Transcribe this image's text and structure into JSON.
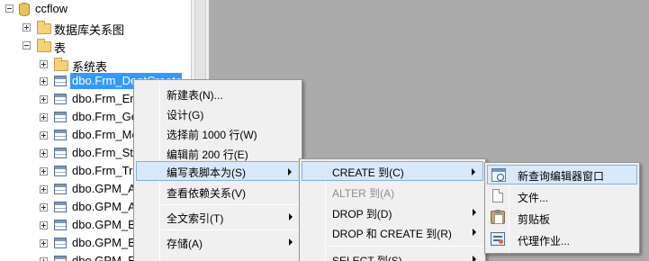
{
  "tree": {
    "nodes": [
      {
        "label": "ccflow",
        "icon": "database-icon",
        "expanded": true
      },
      {
        "label": "数据库关系图",
        "icon": "folder-icon",
        "expanded": false
      },
      {
        "label": "表",
        "icon": "folder-icon",
        "expanded": true
      },
      {
        "label": "系统表",
        "icon": "folder-icon",
        "expanded": false
      },
      {
        "label": "dbo.Frm_DeptCreate",
        "icon": "table-icon",
        "expanded": false,
        "selected": true
      },
      {
        "label": "dbo.Frm_Em",
        "icon": "table-icon",
        "expanded": false
      },
      {
        "label": "dbo.Frm_Ge",
        "icon": "table-icon",
        "expanded": false
      },
      {
        "label": "dbo.Frm_Me",
        "icon": "table-icon",
        "expanded": false
      },
      {
        "label": "dbo.Frm_Sta",
        "icon": "table-icon",
        "expanded": false
      },
      {
        "label": "dbo.Frm_Tra",
        "icon": "table-icon",
        "expanded": false
      },
      {
        "label": "dbo.GPM_A",
        "icon": "table-icon",
        "expanded": false
      },
      {
        "label": "dbo.GPM_A",
        "icon": "table-icon",
        "expanded": false
      },
      {
        "label": "dbo.GPM_B",
        "icon": "table-icon",
        "expanded": false
      },
      {
        "label": "dbo.GPM_B",
        "icon": "table-icon",
        "expanded": false
      },
      {
        "label": "dbo.GPM_E",
        "icon": "table-icon",
        "expanded": false
      }
    ]
  },
  "context_menu": {
    "items": [
      {
        "label": "新建表(N)...",
        "submenu": false,
        "highlighted": false,
        "disabled": false
      },
      {
        "label": "设计(G)",
        "submenu": false,
        "highlighted": false,
        "disabled": false
      },
      {
        "label": "选择前 1000 行(W)",
        "submenu": false,
        "highlighted": false,
        "disabled": false
      },
      {
        "label": "编辑前 200 行(E)",
        "submenu": false,
        "highlighted": false,
        "disabled": false
      },
      {
        "label": "编写表脚本为(S)",
        "submenu": true,
        "highlighted": true,
        "disabled": false
      },
      {
        "label": "查看依赖关系(V)",
        "submenu": false,
        "highlighted": false,
        "disabled": false
      },
      {
        "label": "全文索引(T)",
        "submenu": true,
        "highlighted": false,
        "disabled": false
      },
      {
        "label": "存储(A)",
        "submenu": true,
        "highlighted": false,
        "disabled": false
      }
    ]
  },
  "script_menu": {
    "items": [
      {
        "label": "CREATE 到(C)",
        "submenu": true,
        "highlighted": true,
        "disabled": false
      },
      {
        "label": "ALTER 到(A)",
        "submenu": false,
        "highlighted": false,
        "disabled": true
      },
      {
        "label": "DROP 到(D)",
        "submenu": true,
        "highlighted": false,
        "disabled": false
      },
      {
        "label": "DROP 和 CREATE 到(R)",
        "submenu": true,
        "highlighted": false,
        "disabled": false
      },
      {
        "label": "SELECT 到(S)",
        "submenu": true,
        "highlighted": false,
        "disabled": false
      }
    ]
  },
  "target_menu": {
    "items": [
      {
        "label": "新查询编辑器窗口",
        "icon": "query-window-icon",
        "highlighted": true
      },
      {
        "label": "文件...",
        "icon": "file-icon",
        "highlighted": false
      },
      {
        "label": "剪贴板",
        "icon": "clipboard-icon",
        "highlighted": false
      },
      {
        "label": "代理作业...",
        "icon": "agent-job-icon",
        "highlighted": false
      }
    ]
  },
  "colors": {
    "selection": "#3399ff",
    "menu_highlight": "#d9e8fa",
    "workspace": "#ababab"
  }
}
